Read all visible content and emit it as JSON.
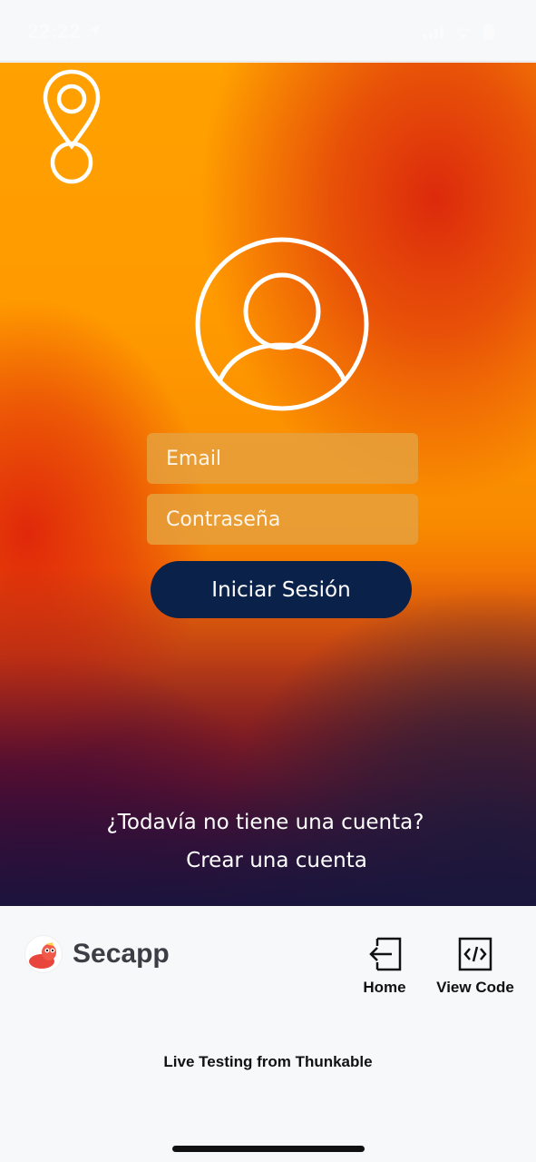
{
  "status_bar": {
    "time": "22:22",
    "location_icon": "location-arrow-icon",
    "signal_icon": "cellular-signal-icon",
    "wifi_icon": "wifi-icon",
    "battery_icon": "battery-icon"
  },
  "login": {
    "email_placeholder": "Email",
    "password_placeholder": "Contraseña",
    "login_button_label": "Iniciar Sesión",
    "no_account_text": "¿Todavía no tiene una cuenta?",
    "create_account_label": "Crear una cuenta",
    "logo_icon": "map-pin-icon",
    "avatar_icon": "user-circle-icon"
  },
  "thunkable": {
    "app_name": "Secapp",
    "home_label": "Home",
    "view_code_label": "View Code",
    "live_testing_text": "Live Testing from Thunkable"
  },
  "colors": {
    "button_bg": "#0a214a",
    "field_bg": "#e6a03c",
    "gradient_top": "#ffa100",
    "gradient_red": "#dc2a0c",
    "gradient_bottom": "#2a1a48"
  }
}
